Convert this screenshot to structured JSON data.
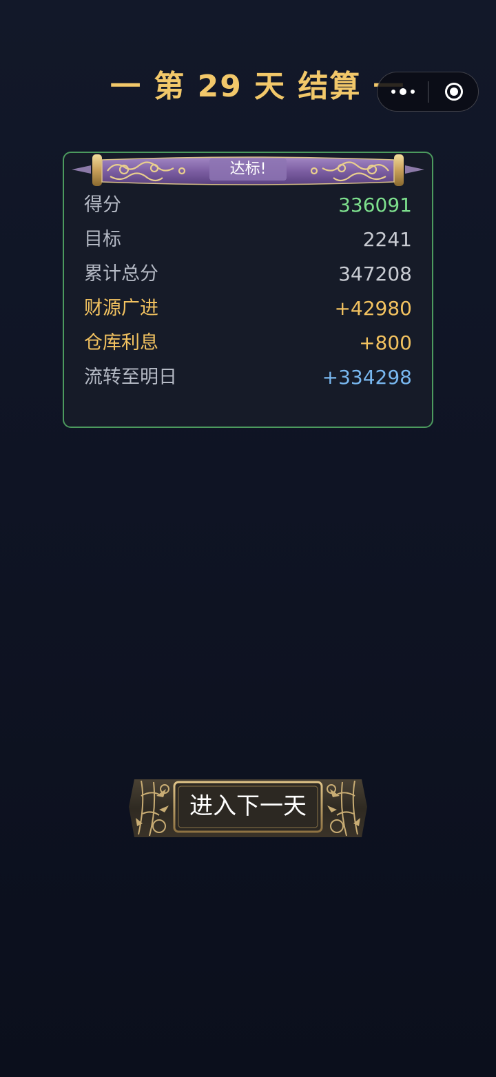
{
  "header": {
    "title": "一 第 29 天 结算 一"
  },
  "capsule": {
    "more_icon": "more-dots-icon",
    "close_icon": "target-close-icon"
  },
  "result": {
    "banner_label": "达标!",
    "rows": [
      {
        "label": "得分",
        "value": "336091"
      },
      {
        "label": "目标",
        "value": "2241"
      },
      {
        "label": "累计总分",
        "value": "347208"
      },
      {
        "label": "财源广进",
        "value": "+42980"
      },
      {
        "label": "仓库利息",
        "value": "+800"
      },
      {
        "label": "流转至明日",
        "value": "+334298"
      }
    ]
  },
  "actions": {
    "next_day_label": "进入下一天"
  },
  "colors": {
    "background": "#0f1424",
    "title_gold": "#f2c86a",
    "panel_border": "#4c9a5e",
    "score_green": "#7ddf8d",
    "bonus_gold": "#f2c260",
    "carry_blue": "#79b8f0"
  }
}
